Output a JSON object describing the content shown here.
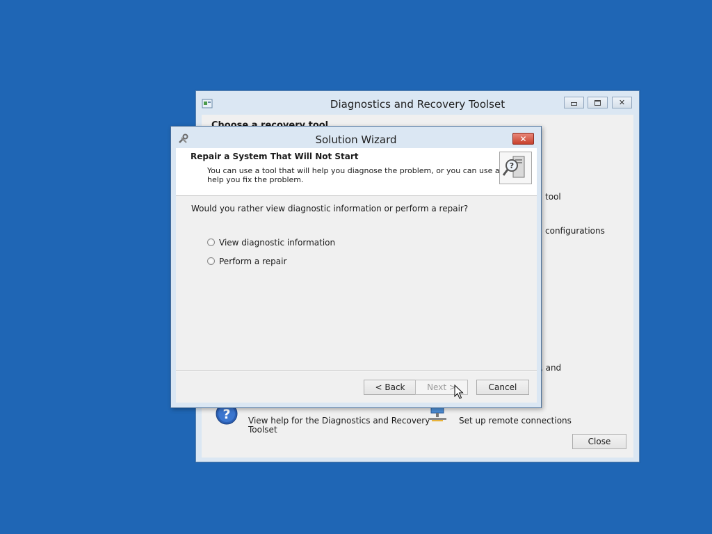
{
  "main_window": {
    "title": "Diagnostics and Recovery Toolset",
    "heading": "Choose a recovery tool",
    "partial_texts": [
      "tool",
      "configurations",
      "ts, and"
    ],
    "help_link_text": "View help for the Diagnostics and Recovery",
    "help_link_text2": "Toolset",
    "remote_text": "Set up remote connections",
    "close_button": "Close",
    "minimize_icon": "minimize-icon",
    "maximize_icon": "maximize-icon",
    "close_icon": "close-icon"
  },
  "wizard": {
    "title": "Solution Wizard",
    "header_title": "Repair a System That Will Not Start",
    "header_desc_line1": "You can use a tool that will help you diagnose the problem, or you can use a tool to",
    "header_desc_line2": "help you fix the problem.",
    "question": "Would you rather view diagnostic information or perform a repair?",
    "options": [
      {
        "label": "View diagnostic information",
        "selected": false
      },
      {
        "label": "Perform a repair",
        "selected": false
      }
    ],
    "buttons": {
      "back": "< Back",
      "next": "Next >",
      "cancel": "Cancel"
    },
    "next_enabled": false
  },
  "colors": {
    "desktop": "#1f66b5",
    "window_frame": "#dbe7f3",
    "close_red": "#c7412d"
  }
}
